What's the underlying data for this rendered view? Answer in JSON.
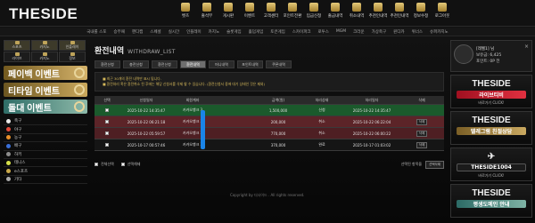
{
  "header": {
    "logo": "THESIDE",
    "nav": [
      "벳츠",
      "출석부",
      "게시판",
      "이벤트",
      "고객센터",
      "포인트전환",
      "입금신청",
      "출금내역",
      "취소내역",
      "추천인내역",
      "추천인내역",
      "정보수정",
      "로그아웃"
    ]
  },
  "subnav": [
    "국내룰 스포",
    "승무패",
    "핸디캡",
    "스페셜",
    "실시간",
    "인플레이",
    "카지노",
    "슬롯게임",
    "홀덤게임",
    "토큰게임",
    "스카이파크",
    "로투스",
    "MGM",
    "크라운",
    "가상축구",
    "윈디카",
    "위너스",
    "슈퍼카지노"
  ],
  "sidebar": {
    "buttons": [
      "스포츠",
      "카지노",
      "인플레이",
      "라이브",
      "카지노",
      "정보"
    ],
    "banners": [
      "페이백 이벤트",
      "티타임 이벤트",
      "돌대 이벤트"
    ],
    "sports": [
      {
        "label": "축구",
        "color": "#e9e9e9"
      },
      {
        "label": "야구",
        "color": "#e24a3a"
      },
      {
        "label": "농구",
        "color": "#e8902a"
      },
      {
        "label": "배구",
        "color": "#3a6fd8"
      },
      {
        "label": "하키",
        "color": "#8c8c8c"
      },
      {
        "label": "테니스",
        "color": "#d6e04a"
      },
      {
        "label": "e스포츠",
        "color": "#c9a84a"
      },
      {
        "label": "기타",
        "color": "#aaaaaa"
      }
    ]
  },
  "main": {
    "title": "환전내역",
    "subtitle": "WITHDRAW_LIST",
    "tabs": [
      "환전신청",
      "충전신청",
      "환전신청",
      "환전내역",
      "머니내역",
      "포인트내역",
      "쿠폰내역"
    ],
    "active_tab": 3,
    "notices": [
      "■ 최근 30개의 환전 내역만 표시 됩니다.",
      "■ 환전처리 혹은 환전취소 된 후에는 해당 신청서를 삭제 할 수 있습니다. (환전신청서 중에 대기 상태인 것은 제외)"
    ],
    "columns": [
      "선택",
      "신청일자",
      "회원계좌",
      "금액(원)",
      "처리상태",
      "처리일자",
      "삭제"
    ],
    "rows": [
      {
        "date": "2025-10-22 14:35:47",
        "account": "카카오뱅크 3",
        "amount": "1,500,000",
        "status": "신청",
        "done": "2025-10-22 14:35:47",
        "btn": "",
        "style": "green"
      },
      {
        "date": "2025-10-22 06:21:18",
        "account": "카카오뱅크 3",
        "amount": "200,000",
        "status": "취소",
        "done": "2025-10-22 06:22:04",
        "btn": "삭제",
        "style": "red1"
      },
      {
        "date": "2025-10-22 05:59:57",
        "account": "카카오뱅크 3",
        "amount": "770,000",
        "status": "취소",
        "done": "2025-10-22 06:00:22",
        "btn": "삭제",
        "style": "red2"
      },
      {
        "date": "2025-10-17 00:57:46",
        "account": "카카오뱅크 3",
        "amount": "370,000",
        "status": "완료",
        "done": "2025-10-17 01:03:02",
        "btn": "삭제",
        "style": "dark"
      }
    ],
    "select_all": "전체선택",
    "deselect_all": "선택해제",
    "selected_label": "선택된 항목을",
    "delete_selected": "선택삭제",
    "copyright": "Copyright by 더사이드 . All rights reserved."
  },
  "user": {
    "name": "[레벨1] 님",
    "money": "보유금: 6,425",
    "point": "포인트: 0P 전",
    "close": "×"
  },
  "promos": [
    {
      "title": "THESIDE",
      "label": "라이브티비",
      "caption": "바로가기 CLICK!",
      "style": "red"
    },
    {
      "title": "THESIDE",
      "label": "텔레그램 친절상담",
      "caption": "",
      "style": "gold"
    },
    {
      "title": "",
      "label": "THESIDE1004",
      "caption": "바로가기 CLICK!",
      "style": "tg"
    },
    {
      "title": "THESIDE",
      "label": "평생도메인 안내",
      "caption": "",
      "style": "teal"
    }
  ]
}
